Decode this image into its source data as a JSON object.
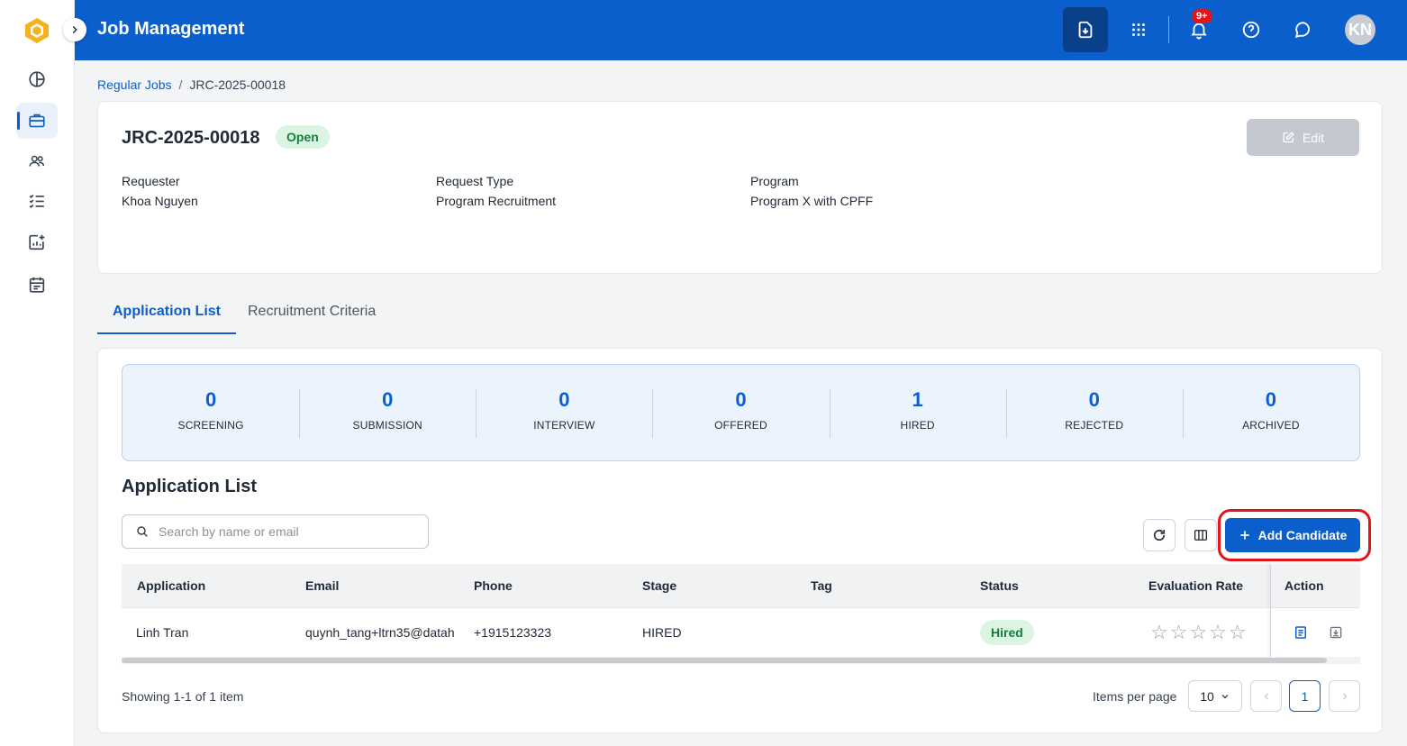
{
  "topbar": {
    "title": "Job Management",
    "notification_count": "9+",
    "avatar_initials": "KN"
  },
  "sidebar": {
    "items": [
      {
        "icon": "dashboard-icon"
      },
      {
        "icon": "briefcase-icon",
        "active": true
      },
      {
        "icon": "users-icon"
      },
      {
        "icon": "checklist-icon"
      },
      {
        "icon": "chart-add-icon"
      },
      {
        "icon": "calendar-icon"
      }
    ]
  },
  "breadcrumb": {
    "parent": "Regular Jobs",
    "separator": "/",
    "current": "JRC-2025-00018"
  },
  "job": {
    "code": "JRC-2025-00018",
    "status": "Open",
    "edit_label": "Edit",
    "requester_label": "Requester",
    "requester_value": "Khoa Nguyen",
    "request_type_label": "Request Type",
    "request_type_value": "Program Recruitment",
    "program_label": "Program",
    "program_value": "Program X with CPFF"
  },
  "tabs": [
    {
      "label": "Application List",
      "active": true
    },
    {
      "label": "Recruitment Criteria",
      "active": false
    }
  ],
  "stats": [
    {
      "value": "0",
      "label": "SCREENING"
    },
    {
      "value": "0",
      "label": "SUBMISSION"
    },
    {
      "value": "0",
      "label": "INTERVIEW"
    },
    {
      "value": "0",
      "label": "OFFERED"
    },
    {
      "value": "1",
      "label": "HIRED"
    },
    {
      "value": "0",
      "label": "REJECTED"
    },
    {
      "value": "0",
      "label": "ARCHIVED"
    }
  ],
  "application_list": {
    "title": "Application List",
    "search_placeholder": "Search by name or email",
    "add_candidate_label": "Add Candidate",
    "columns": [
      "Application",
      "Email",
      "Phone",
      "Stage",
      "Tag",
      "Status",
      "Evaluation Rate",
      "Action"
    ],
    "rows": [
      {
        "application": "Linh Tran",
        "email": "quynh_tang+ltrn35@datah",
        "phone": "+1915123323",
        "stage": "HIRED",
        "tag": "",
        "status": "Hired",
        "rating": "☆☆☆☆☆"
      }
    ]
  },
  "pagination": {
    "showing": "Showing 1-1 of 1 item",
    "items_per_page_label": "Items per page",
    "items_per_page_value": "10",
    "current_page": "1"
  },
  "colors": {
    "primary": "#0b5fcc",
    "success_bg": "#dcf5e3",
    "success_text": "#15803d",
    "highlight": "#e3151a"
  }
}
